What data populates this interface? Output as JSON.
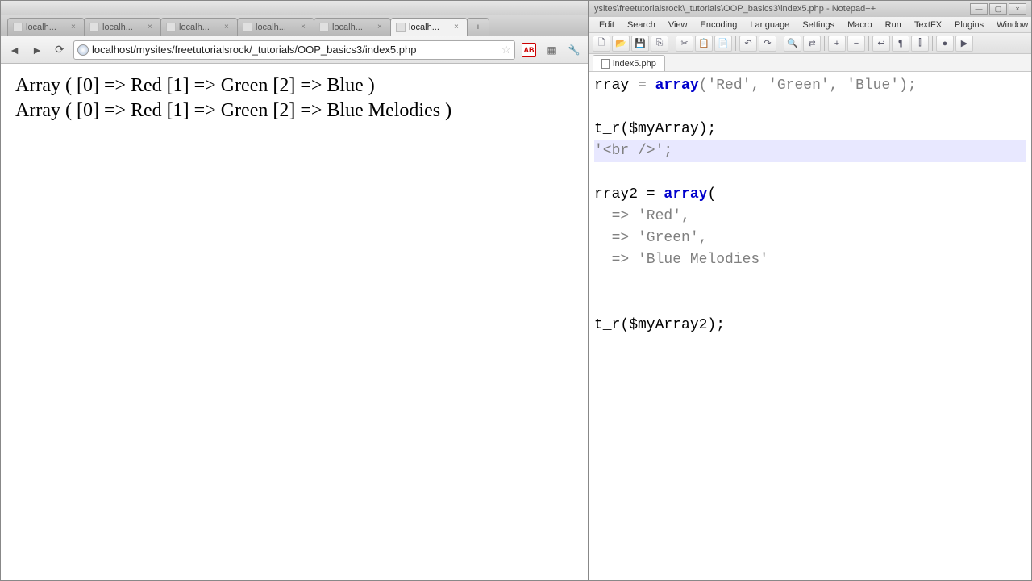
{
  "browser": {
    "tabs": [
      {
        "label": "localh..."
      },
      {
        "label": "localh..."
      },
      {
        "label": "localh..."
      },
      {
        "label": "localh..."
      },
      {
        "label": "localh..."
      },
      {
        "label": "localh...",
        "active": true
      }
    ],
    "url": "localhost/mysites/freetutorialsrock/_tutorials/OOP_basics3/index5.php",
    "page_lines": [
      "Array ( [0] => Red [1] => Green [2] => Blue )",
      "Array ( [0] => Red [1] => Green [2] => Blue Melodies )"
    ]
  },
  "npp": {
    "title": "ysites\\freetutorialsrock\\_tutorials\\OOP_basics3\\index5.php - Notepad++",
    "menu": [
      "Edit",
      "Search",
      "View",
      "Encoding",
      "Language",
      "Settings",
      "Macro",
      "Run",
      "TextFX",
      "Plugins",
      "Window",
      "?"
    ],
    "file_tab": "index5.php",
    "code": {
      "l1": "rray = ",
      "l1_kw": "array",
      "l1_rest": "('Red', 'Green', 'Blue');",
      "l2": "t_r($myArray);",
      "l3": "'<br />';",
      "l4a": "rray2 = ",
      "l4_kw": "array",
      "l4b": "(",
      "l5": "  => 'Red',",
      "l6": "  => 'Green',",
      "l7": "  => 'Blue Melodies'",
      "l8": "t_r($myArray2);"
    }
  }
}
